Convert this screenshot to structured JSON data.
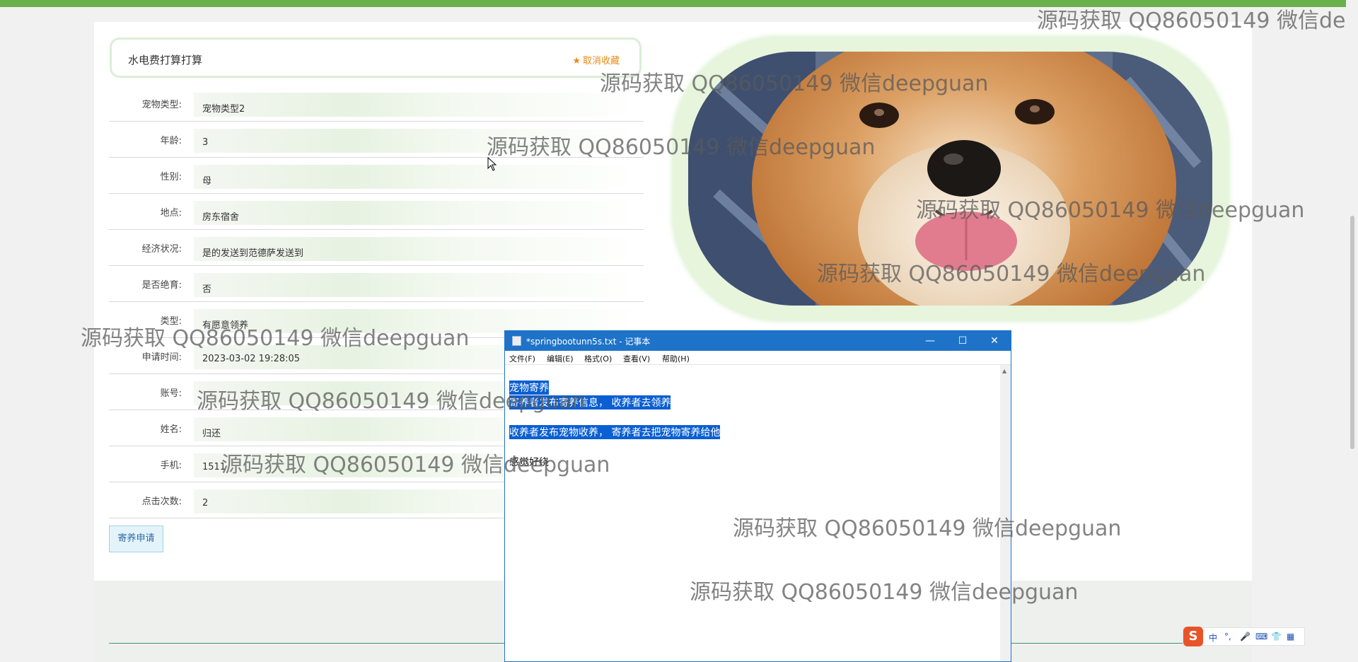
{
  "page": {
    "title": "水电费打算打算",
    "favorite_label": "取消收藏",
    "apply_label": "寄养申请"
  },
  "details": [
    {
      "label": "宠物类型:",
      "value": "宠物类型2"
    },
    {
      "label": "年龄:",
      "value": "3"
    },
    {
      "label": "性别:",
      "value": "母"
    },
    {
      "label": "地点:",
      "value": "房东宿舍"
    },
    {
      "label": "经济状况:",
      "value": "是的发送到范德萨发送到"
    },
    {
      "label": "是否绝育:",
      "value": "否"
    },
    {
      "label": "类型:",
      "value": "有愿意领养"
    },
    {
      "label": "申请时间:",
      "value": "2023-03-02 19:28:05"
    },
    {
      "label": "账号:",
      "value": ""
    },
    {
      "label": "姓名:",
      "value": "归还"
    },
    {
      "label": "手机:",
      "value": "1511"
    },
    {
      "label": "点击次数:",
      "value": "2"
    }
  ],
  "watermark": "源码获取 QQ86050149 微信deepguan",
  "notepad": {
    "title": "*springbootunn5s.txt - 记事本",
    "menus": [
      "文件(F)",
      "编辑(E)",
      "格式(O)",
      "查看(V)",
      "帮助(H)"
    ],
    "lines": [
      "宠物寄养",
      "寄养者发布寄养信息， 收养者去领养",
      "收养者发布宠物收养， 寄养者去把宠物寄养给他",
      "感觉好绕"
    ],
    "minimize": "—",
    "maximize": "☐",
    "close": "✕"
  },
  "ime": {
    "logo": "S",
    "mode": "中",
    "punct": "°,",
    "items": [
      "中",
      "°,",
      "🎤",
      "⌨",
      "👕",
      "▦"
    ]
  },
  "colors": {
    "topbar": "#6ab04c",
    "accent_orange": "#e98a18",
    "notepad_blue": "#1e73c8",
    "selection": "#0a5fd3"
  }
}
